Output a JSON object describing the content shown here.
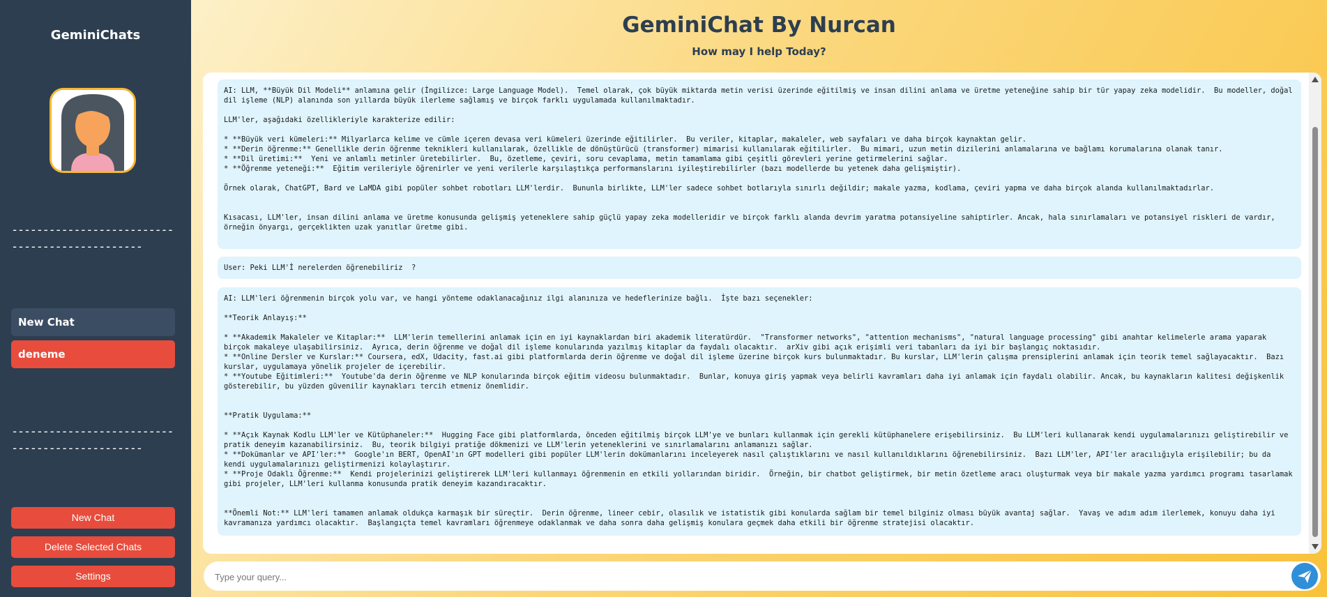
{
  "sidebar": {
    "title": "GeminiChats",
    "divider_top": "-----------------------------------------------",
    "divider_bottom": "-----------------------------------------------",
    "chats": [
      {
        "label": "New Chat"
      },
      {
        "label": "deneme"
      }
    ],
    "buttons": {
      "new_chat": "New Chat",
      "delete_selected": "Delete Selected Chats",
      "settings": "Settings"
    }
  },
  "header": {
    "title": "GeminiChat By Nurcan",
    "subtitle": "How may I help Today?"
  },
  "messages": [
    {
      "role": "AI",
      "text": "AI: LLM, **Büyük Dil Modeli** anlamına gelir (İngilizce: Large Language Model).  Temel olarak, çok büyük miktarda metin verisi üzerinde eğitilmiş ve insan dilini anlama ve üretme yeteneğine sahip bir tür yapay zeka modelidir.  Bu modeller, doğal dil işleme (NLP) alanında son yıllarda büyük ilerleme sağlamış ve birçok farklı uygulamada kullanılmaktadır.\n\nLLM'ler, aşağıdaki özellikleriyle karakterize edilir:\n\n* **Büyük veri kümeleri:** Milyarlarca kelime ve cümle içeren devasa veri kümeleri üzerinde eğitilirler.  Bu veriler, kitaplar, makaleler, web sayfaları ve daha birçok kaynaktan gelir.\n* **Derin öğrenme:** Genellikle derin öğrenme teknikleri kullanılarak, özellikle de dönüştürücü (transformer) mimarisi kullanılarak eğitilirler.  Bu mimari, uzun metin dizilerini anlamalarına ve bağlamı korumalarına olanak tanır.\n* **Dil üretimi:**  Yeni ve anlamlı metinler üretebilirler.  Bu, özetleme, çeviri, soru cevaplama, metin tamamlama gibi çeşitli görevleri yerine getirmelerini sağlar.\n* **Öğrenme yeteneği:**  Eğitim verileriyle öğrenirler ve yeni verilerle karşılaştıkça performanslarını iyileştirebilirler (bazı modellerde bu yetenek daha gelişmiştir).\n\nÖrnek olarak, ChatGPT, Bard ve LaMDA gibi popüler sohbet robotları LLM'lerdir.  Bununla birlikte, LLM'ler sadece sohbet botlarıyla sınırlı değildir; makale yazma, kodlama, çeviri yapma ve daha birçok alanda kullanılmaktadırlar.\n\n\nKısacası, LLM'ler, insan dilini anlama ve üretme konusunda gelişmiş yeteneklere sahip güçlü yapay zeka modelleridir ve birçok farklı alanda devrim yaratma potansiyeline sahiptirler. Ancak, hala sınırlamaları ve potansiyel riskleri de vardır, örneğin önyargı, gerçeklikten uzak yanıtlar üretme gibi."
    },
    {
      "role": "User",
      "text": "User: Peki LLM'İ nerelerden öğrenebiliriz  ?"
    },
    {
      "role": "AI",
      "text": "AI: LLM'leri öğrenmenin birçok yolu var, ve hangi yönteme odaklanacağınız ilgi alanınıza ve hedeflerinize bağlı.  İşte bazı seçenekler:\n\n**Teorik Anlayış:**\n\n* **Akademik Makaleler ve Kitaplar:**  LLM'lerin temellerini anlamak için en iyi kaynaklardan biri akademik literatürdür.  \"Transformer networks\", \"attention mechanisms\", \"natural language processing\" gibi anahtar kelimelerle arama yaparak birçok makaleye ulaşabilirsiniz.  Ayrıca, derin öğrenme ve doğal dil işleme konularında yazılmış kitaplar da faydalı olacaktır.  arXiv gibi açık erişimli veri tabanları da iyi bir başlangıç noktasıdır.\n* **Online Dersler ve Kurslar:** Coursera, edX, Udacity, fast.ai gibi platformlarda derin öğrenme ve doğal dil işleme üzerine birçok kurs bulunmaktadır. Bu kurslar, LLM'lerin çalışma prensiplerini anlamak için teorik temel sağlayacaktır.  Bazı kurslar, uygulamaya yönelik projeler de içerebilir.\n* **Youtube Eğitimleri:**  Youtube'da derin öğrenme ve NLP konularında birçok eğitim videosu bulunmaktadır.  Bunlar, konuya giriş yapmak veya belirli kavramları daha iyi anlamak için faydalı olabilir. Ancak, bu kaynakların kalitesi değişkenlik gösterebilir, bu yüzden güvenilir kaynakları tercih etmeniz önemlidir.\n\n\n**Pratik Uygulama:**\n\n* **Açık Kaynak Kodlu LLM'ler ve Kütüphaneler:**  Hugging Face gibi platformlarda, önceden eğitilmiş birçok LLM'ye ve bunları kullanmak için gerekli kütüphanelere erişebilirsiniz.  Bu LLM'leri kullanarak kendi uygulamalarınızı geliştirebilir ve pratik deneyim kazanabilirsiniz.  Bu, teorik bilgiyi pratiğe dökmenizi ve LLM'lerin yeteneklerini ve sınırlamalarını anlamanızı sağlar.\n* **Dokümanlar ve API'ler:**  Google'ın BERT, OpenAI'ın GPT modelleri gibi popüler LLM'lerin dokümanlarını inceleyerek nasıl çalıştıklarını ve nasıl kullanıldıklarını öğrenebilirsiniz.  Bazı LLM'ler, API'ler aracılığıyla erişilebilir; bu da kendi uygulamalarınızı geliştirmenizi kolaylaştırır.\n* **Proje Odaklı Öğrenme:**  Kendi projelerinizi geliştirerek LLM'leri kullanmayı öğrenmenin en etkili yollarından biridir.  Örneğin, bir chatbot geliştirmek, bir metin özetleme aracı oluşturmak veya bir makale yazma yardımcı programı tasarlamak gibi projeler, LLM'leri kullanma konusunda pratik deneyim kazandıracaktır.\n\n\n**Önemli Not:** LLM'leri tamamen anlamak oldukça karmaşık bir süreçtir.  Derin öğrenme, lineer cebir, olasılık ve istatistik gibi konularda sağlam bir temel bilginiz olması büyük avantaj sağlar.  Yavaş ve adım adım ilerlemek, konuyu daha iyi kavramanıza yardımcı olacaktır.  Başlangıçta temel kavramları öğrenmeye odaklanmak ve daha sonra daha gelişmiş konulara geçmek daha etkili bir öğrenme stratejisi olacaktır."
    }
  ],
  "input": {
    "placeholder": "Type your query...",
    "value": ""
  },
  "icons": {
    "send": "paper-plane-icon",
    "avatar": "user-avatar"
  },
  "colors": {
    "sidebar_bg": "#2d3e50",
    "accent_red": "#e74c3c",
    "avatar_border": "#f7b733",
    "message_bg": "#dff4fc",
    "send_button": "#2f8fd8"
  }
}
